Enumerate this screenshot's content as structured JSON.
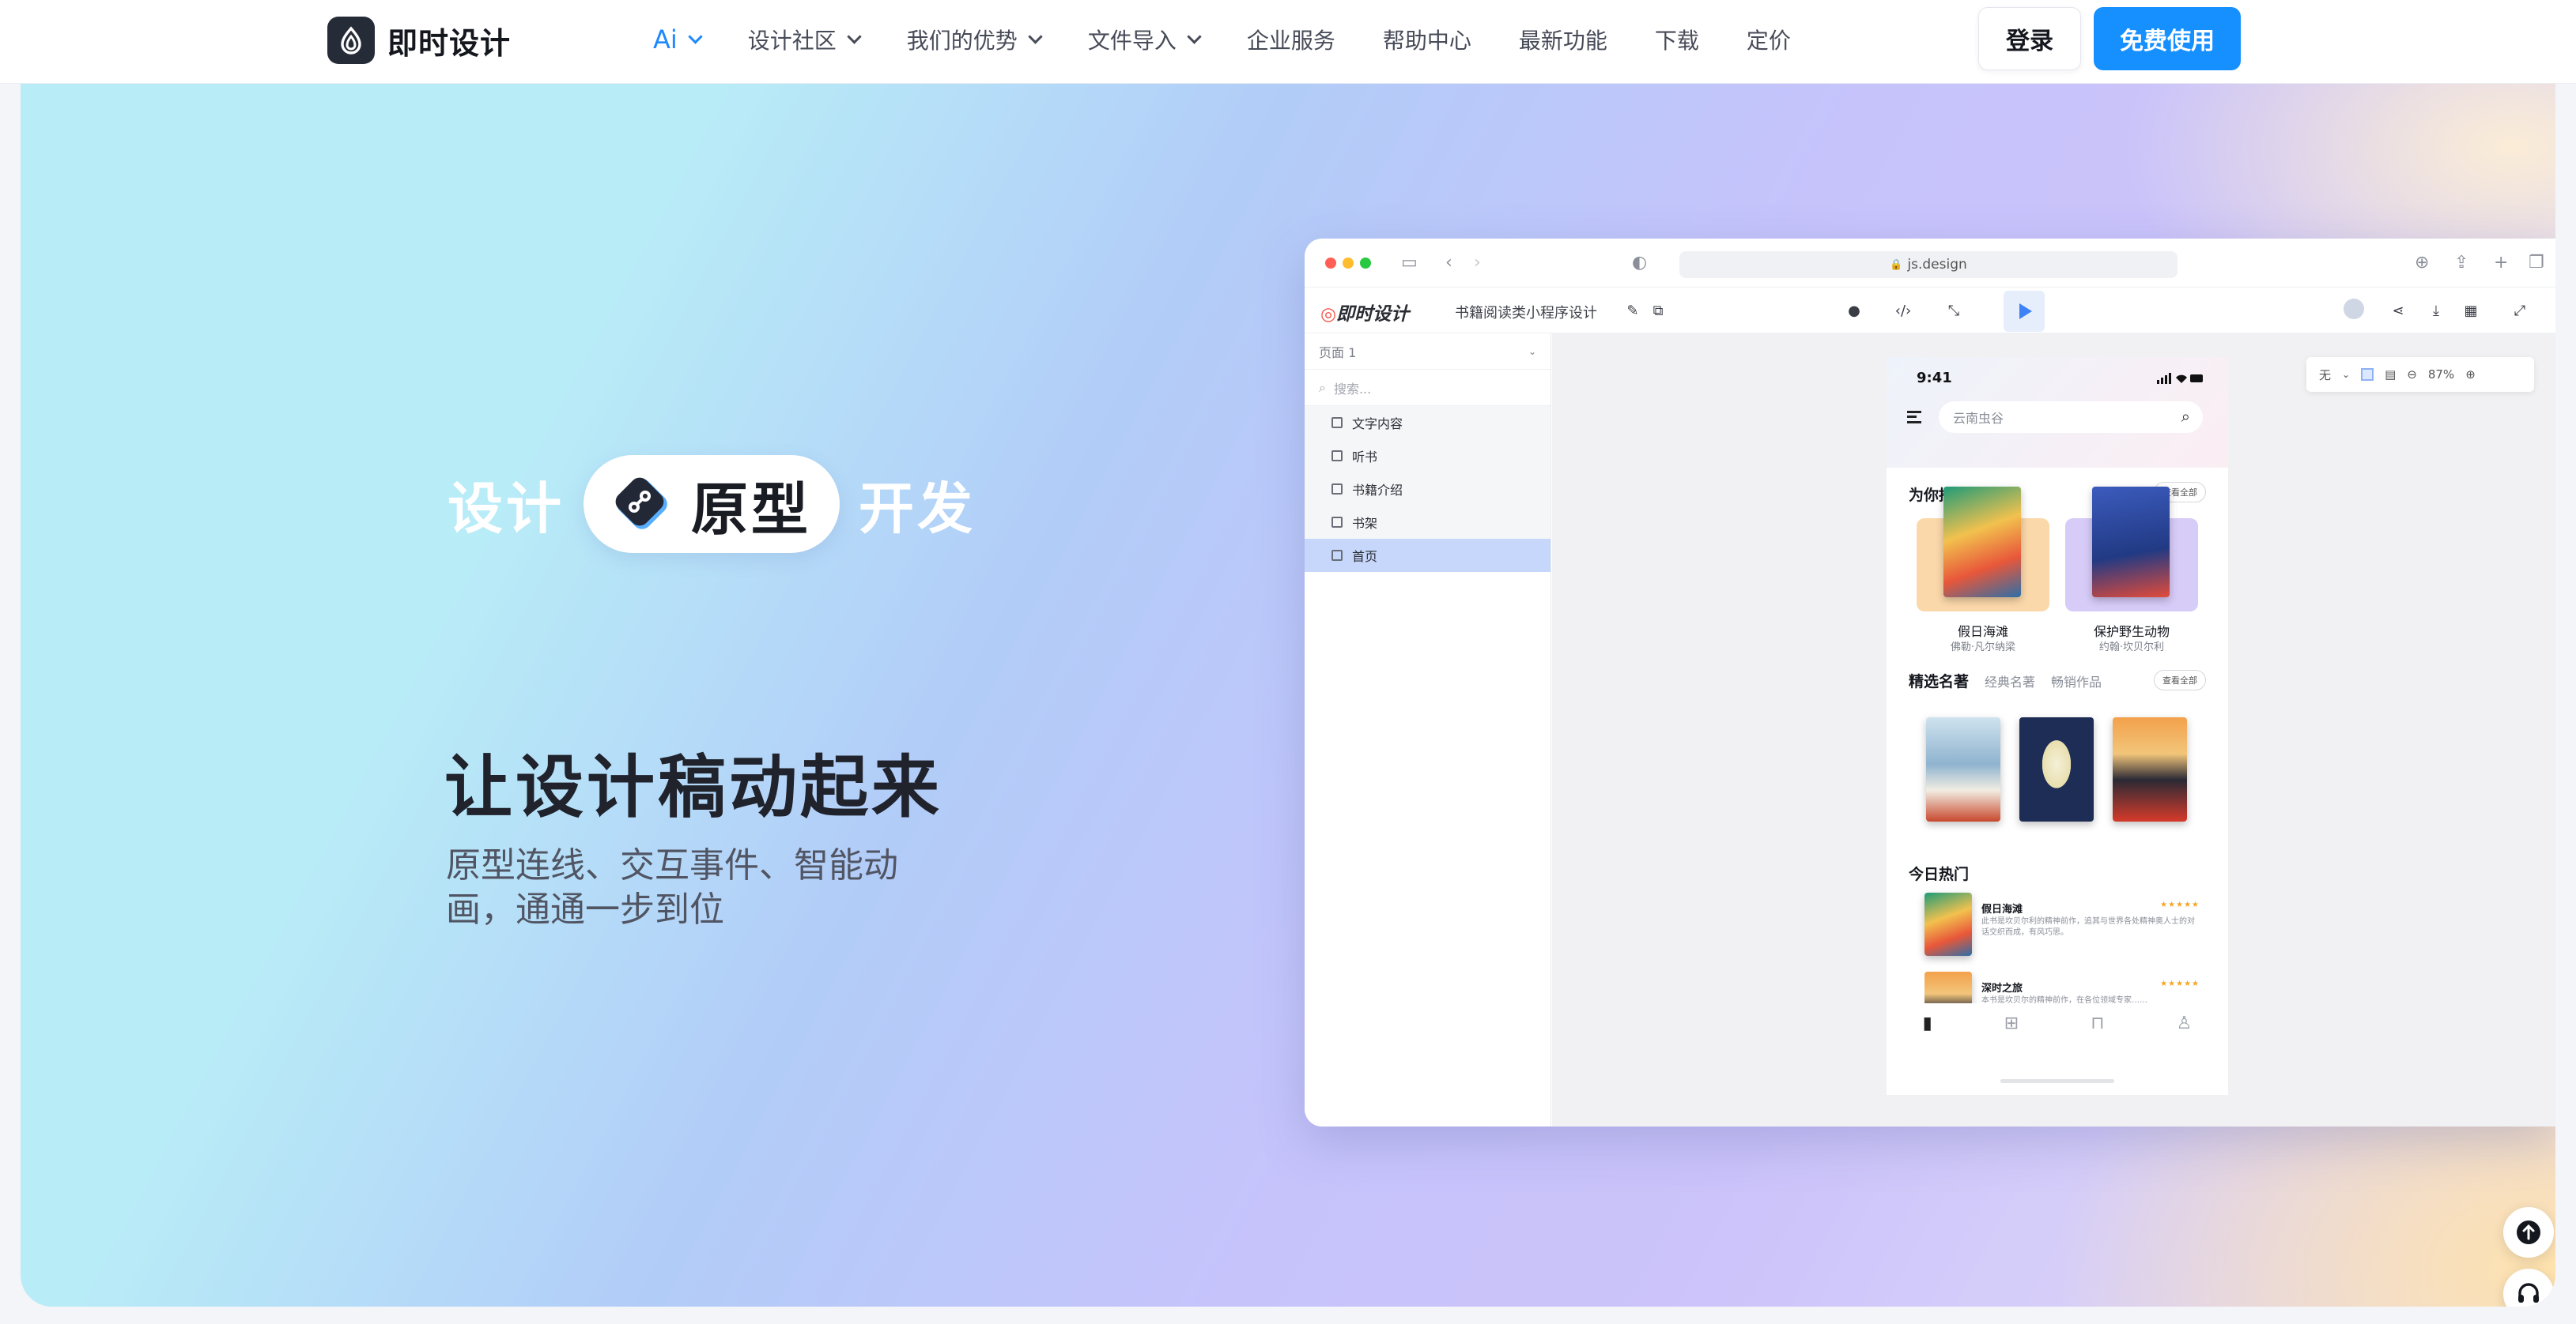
{
  "brand": {
    "name": "即时设计"
  },
  "nav": {
    "items": [
      {
        "label": "Ai",
        "dropdown": true
      },
      {
        "label": "设计社区",
        "dropdown": true
      },
      {
        "label": "我们的优势",
        "dropdown": true
      },
      {
        "label": "文件导入",
        "dropdown": true
      },
      {
        "label": "企业服务"
      },
      {
        "label": "帮助中心"
      },
      {
        "label": "最新功能"
      },
      {
        "label": "下载"
      },
      {
        "label": "定价"
      }
    ],
    "login": "登录",
    "free": "免费使用"
  },
  "hero": {
    "tag_left": "设计",
    "tag_center": "原型",
    "tag_right": "开发",
    "title": "让设计稿动起来",
    "subtitle_line1": "原型连线、交互事件、智能动",
    "subtitle_line2": "画，通通一步到位"
  },
  "mock": {
    "url": "js.design",
    "app_brand": "即时设计",
    "file_name": "书籍阅读类小程序设计",
    "page_select": "页面 1",
    "search_placeholder": "搜索...",
    "layers": [
      "文字内容",
      "听书",
      "书籍介绍",
      "书架",
      "首页"
    ],
    "selected_layer": "首页",
    "zoom": "87%",
    "fill_none": "无",
    "phone": {
      "time": "9:41",
      "search": "云南虫谷",
      "recommend": "为你推荐",
      "see_all": "查看全部",
      "books": [
        {
          "title": "假日海滩",
          "author": "佛勒·凡尔纳梁"
        },
        {
          "title": "保护野生动物",
          "author": "约翰·坎贝尔利"
        }
      ],
      "tabs": [
        "精选名著",
        "经典名著",
        "畅销作品"
      ],
      "see_all2": "查看全部",
      "hot": "今日热门",
      "hot_items": [
        {
          "title": "假日海滩",
          "desc": "此书是坎贝尔利的精神前作，追其与世界各处精神奥人士的对话交织而成，有风巧思。"
        },
        {
          "title": "深时之旅",
          "desc": "本书是坎贝尔的精神前作，在各位领域专家……"
        }
      ]
    }
  }
}
